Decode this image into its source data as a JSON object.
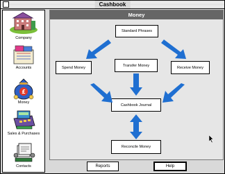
{
  "window": {
    "title": "Cashbook"
  },
  "sidebar": {
    "items": [
      {
        "label": "Company",
        "icon": "building-icon"
      },
      {
        "label": "Accounts",
        "icon": "ledger-icon"
      },
      {
        "label": "Money",
        "icon": "money-bag-icon"
      },
      {
        "label": "Sales & Purchases",
        "icon": "cash-register-icon"
      },
      {
        "label": "Contacts",
        "icon": "rolodex-icon"
      }
    ]
  },
  "main": {
    "title": "Money",
    "buttons": {
      "standard_phrases": "Standard Phrases",
      "spend_money": "Spend Money",
      "transfer_money": "Transfer Money",
      "receive_money": "Receive Money",
      "cashbook_journal": "Cashbook Journal",
      "reconcile_money": "Reconcile Money"
    }
  },
  "footer": {
    "reports_label": "Reports",
    "help_label": "Help"
  },
  "colors": {
    "arrow": "#1f6fd1",
    "header": "#666666",
    "panel": "#e6e6e6"
  }
}
